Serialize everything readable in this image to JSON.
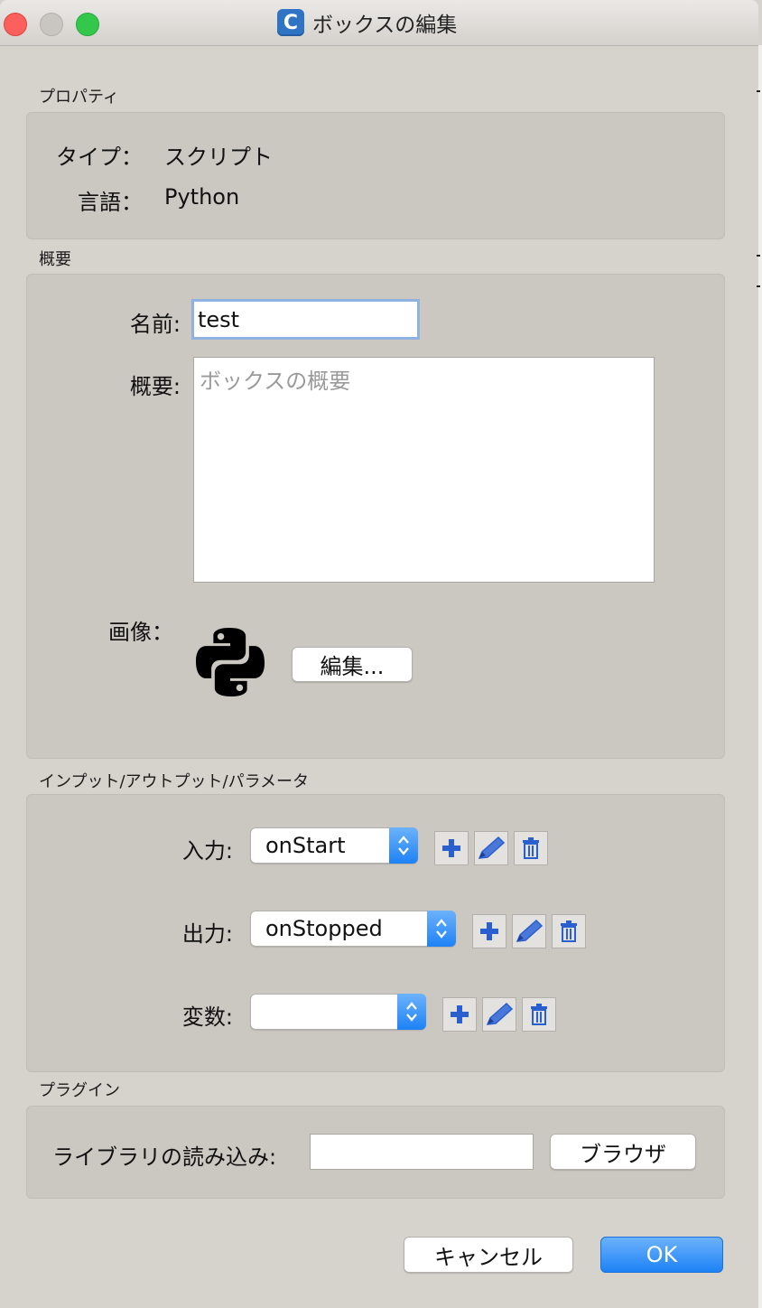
{
  "window": {
    "title": "ボックスの編集",
    "app_icon_letter": "C"
  },
  "properties": {
    "section_label": "プロパティ",
    "type_label": "タイプ：",
    "type_value": "スクリプト",
    "language_label": "言語：",
    "language_value": "Python"
  },
  "overview": {
    "section_label": "概要",
    "name_label": "名前:",
    "name_value": "test",
    "description_label": "概要:",
    "description_placeholder": "ボックスの概要",
    "image_label": "画像：",
    "edit_button": "編集..."
  },
  "io": {
    "section_label": "インプット/アウトプット/パラメータ",
    "input_label": "入力:",
    "input_value": "onStart",
    "output_label": "出力:",
    "output_value": "onStopped",
    "variable_label": "変数:",
    "variable_value": ""
  },
  "plugin": {
    "section_label": "プラグイン",
    "library_label": "ライブラリの読み込み:",
    "library_value": "",
    "browse_button": "ブラウザ"
  },
  "footer": {
    "cancel_button": "キャンセル",
    "ok_button": "OK"
  },
  "colors": {
    "accent": "#1d82f5",
    "icon_blue": "#2a5fd0",
    "panel": "#cbc7c1",
    "window": "#d6d2cc"
  },
  "icons": [
    "close-icon",
    "minimize-icon",
    "zoom-icon",
    "app-icon",
    "python-logo-icon",
    "add-icon",
    "edit-pencil-icon",
    "trash-icon",
    "stepper-arrows-icon"
  ]
}
